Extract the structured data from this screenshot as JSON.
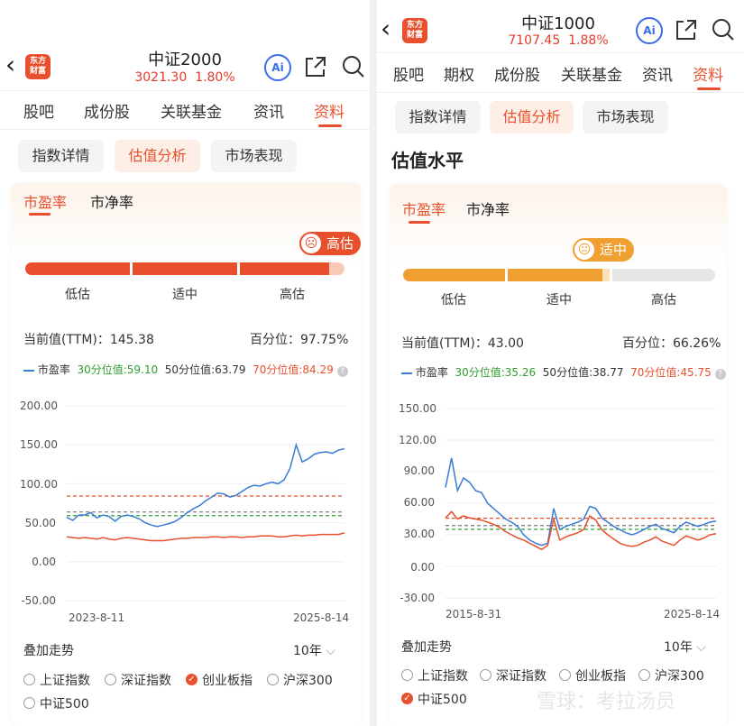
{
  "colors": {
    "accent": "#e8502d",
    "orange": "#f0a030",
    "blue": "#3a7bd5",
    "green": "#2e9d2e",
    "red": "#e8502d",
    "gray": "#777777"
  },
  "left": {
    "header": {
      "title": "中证2000",
      "price": "3021.30",
      "change": "1.80%"
    },
    "tabs": [
      "股吧",
      "成份股",
      "关联基金",
      "资讯",
      "资料"
    ],
    "pills": [
      "指数详情",
      "估值分析",
      "市场表现"
    ],
    "subtabs": [
      "市盈率",
      "市净率"
    ],
    "badge": "高估",
    "levels": [
      "低估",
      "适中",
      "高估"
    ],
    "current_label": "当前值(TTM)：145.38",
    "percentile_label": "百分位：97.75%",
    "legend": {
      "pe": "市盈率",
      "p30": "30分位值:59.10",
      "p50": "50分位值:63.79",
      "p70": "70分位值:84.29"
    },
    "y_ticks": [
      "200.00",
      "150.00",
      "100.00",
      "50.00",
      "0.00",
      "-50.00"
    ],
    "x_start": "2023-8-11",
    "x_end": "2025-8-14",
    "overlay_label": "叠加走势",
    "period": "10年",
    "overlay_options": [
      "上证指数",
      "深证指数",
      "创业板指",
      "沪深300",
      "中证500"
    ],
    "overlay_selected": "创业板指"
  },
  "right": {
    "header": {
      "title": "中证1000",
      "price": "7107.45",
      "change": "1.88%"
    },
    "tabs": [
      "股吧",
      "期权",
      "成份股",
      "关联基金",
      "资讯",
      "资料"
    ],
    "pills": [
      "指数详情",
      "估值分析",
      "市场表现"
    ],
    "section_title": "估值水平",
    "subtabs": [
      "市盈率",
      "市净率"
    ],
    "badge": "适中",
    "levels": [
      "低估",
      "适中",
      "高估"
    ],
    "current_label": "当前值(TTM)：43.00",
    "percentile_label": "百分位：66.26%",
    "legend": {
      "pe": "市盈率",
      "p30": "30分位值:35.26",
      "p50": "50分位值:38.77",
      "p70": "70分位值:45.75"
    },
    "y_ticks": [
      "150.00",
      "120.00",
      "90.00",
      "60.00",
      "30.00",
      "0.00",
      "-30.00"
    ],
    "x_start": "2015-8-31",
    "x_end": "2025-8-14",
    "overlay_label": "叠加走势",
    "period": "10年",
    "overlay_options": [
      "上证指数",
      "深证指数",
      "创业板指",
      "沪深300",
      "中证500"
    ],
    "overlay_selected": "中证500"
  },
  "watermark": "雪球：考拉汤员",
  "chart_data": [
    {
      "type": "line",
      "title": "",
      "x_start": "2023-8-11",
      "x_end": "2025-8-14",
      "ylim": [
        -50,
        200
      ],
      "hlines": {
        "p30": 59.1,
        "p50": 63.79,
        "p70": 84.29
      },
      "series": [
        {
          "name": "市盈率",
          "color": "#3a7bd5",
          "values": [
            57,
            53,
            60,
            60,
            63,
            56,
            60,
            58,
            52,
            58,
            60,
            58,
            55,
            50,
            47,
            45,
            47,
            49,
            52,
            57,
            63,
            68,
            72,
            78,
            83,
            88,
            87,
            83,
            85,
            90,
            95,
            98,
            97,
            100,
            102,
            100,
            105,
            120,
            150,
            128,
            132,
            138,
            140,
            141,
            139,
            143,
            145
          ]
        },
        {
          "name": "",
          "color": "#e8502d",
          "values": [
            32,
            31,
            30,
            31,
            30,
            29,
            31,
            29,
            28,
            30,
            31,
            30,
            29,
            28,
            27,
            27,
            27,
            28,
            29,
            30,
            30,
            31,
            31,
            31,
            32,
            32,
            31,
            32,
            32,
            31,
            32,
            32,
            33,
            33,
            33,
            32,
            32,
            33,
            34,
            33,
            34,
            34,
            35,
            35,
            35,
            35,
            37
          ]
        }
      ]
    },
    {
      "type": "line",
      "title": "",
      "x_start": "2015-8-31",
      "x_end": "2025-8-14",
      "ylim": [
        -30,
        150
      ],
      "hlines": {
        "p30": 35.26,
        "p50": 38.77,
        "p70": 45.75
      },
      "series": [
        {
          "name": "市盈率",
          "color": "#3a7bd5",
          "values": [
            75,
            103,
            72,
            84,
            80,
            72,
            70,
            60,
            55,
            50,
            45,
            42,
            38,
            30,
            25,
            22,
            20,
            22,
            55,
            35,
            38,
            40,
            42,
            45,
            57,
            55,
            46,
            42,
            38,
            35,
            32,
            30,
            32,
            35,
            38,
            40,
            36,
            34,
            32,
            38,
            42,
            40,
            38,
            40,
            42,
            43
          ]
        },
        {
          "name": "",
          "color": "#e8502d",
          "values": [
            46,
            52,
            45,
            48,
            46,
            45,
            44,
            42,
            40,
            37,
            33,
            30,
            27,
            25,
            22,
            19,
            16,
            20,
            45,
            25,
            28,
            30,
            32,
            35,
            48,
            44,
            35,
            30,
            26,
            22,
            20,
            19,
            20,
            23,
            25,
            28,
            24,
            22,
            20,
            25,
            29,
            27,
            25,
            27,
            30,
            31
          ]
        }
      ]
    }
  ]
}
